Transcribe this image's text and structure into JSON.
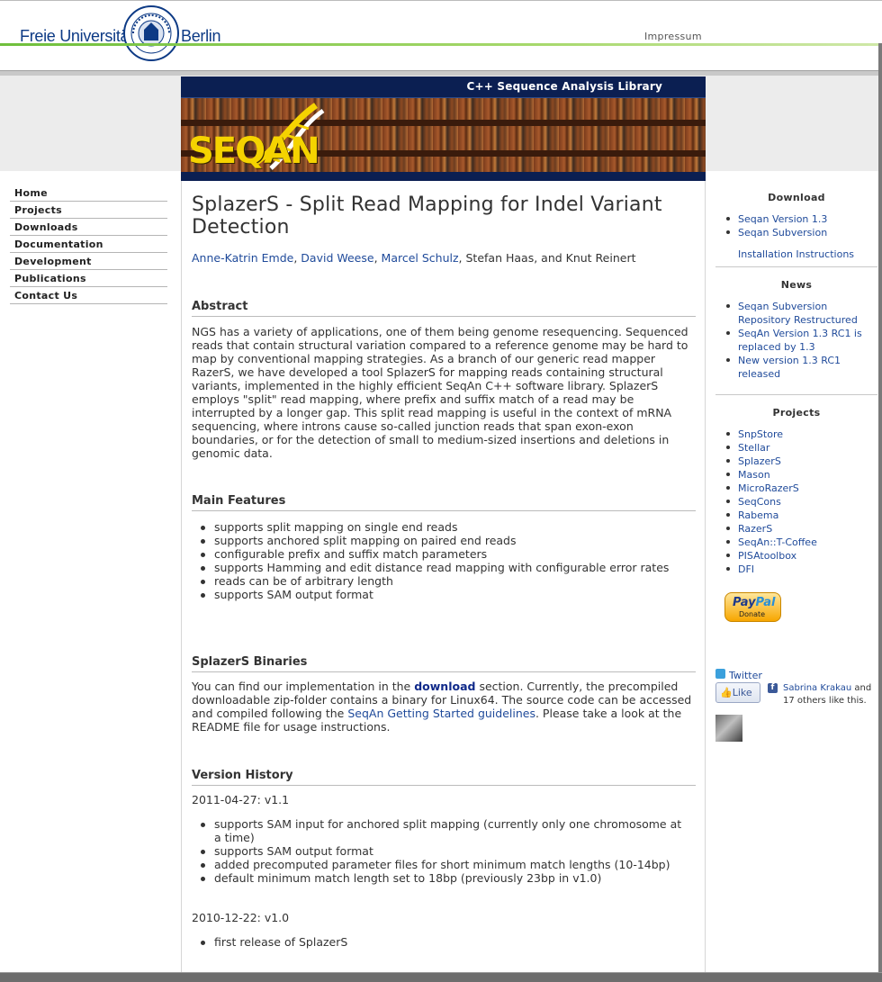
{
  "header": {
    "fu_left": "Freie Universität",
    "fu_right": "Berlin",
    "impressum": "Impressum"
  },
  "banner": {
    "title": "C++ Sequence Analysis Library",
    "logo": "SEQAN"
  },
  "nav": {
    "items": [
      {
        "label": "Home"
      },
      {
        "label": "Projects"
      },
      {
        "label": "Downloads"
      },
      {
        "label": "Documentation"
      },
      {
        "label": "Development"
      },
      {
        "label": "Publications"
      },
      {
        "label": "Contact Us"
      }
    ]
  },
  "main": {
    "title": "SplazerS - Split Read Mapping for Indel Variant Detection",
    "authors": {
      "a1": "Anne-Katrin Emde",
      "a2": "David Weese",
      "a3": "Marcel Schulz",
      "rest": ", Stefan Haas, and Knut Reinert"
    },
    "abstract_heading": "Abstract",
    "abstract_text": "NGS has a variety of applications, one of them being genome resequencing. Sequenced reads that contain structural variation compared to a reference genome may be hard to map by conventional mapping strategies. As a branch of our generic read mapper RazerS, we have developed a tool SplazerS for mapping reads containing structural variants, implemented in the highly efficient SeqAn C++ software library. SplazerS employs \"split\" read mapping, where prefix and suffix match of a read may be interrupted by a longer gap. This split read mapping is useful in the context of mRNA sequencing, where introns cause so-called junction reads that span exon-exon boundaries, or for the detection of small to medium-sized insertions and deletions in genomic data.",
    "features_heading": "Main Features",
    "features": [
      "supports split mapping on single end reads",
      "supports anchored split mapping on paired end reads",
      "configurable prefix and suffix match parameters",
      "supports Hamming and edit distance read mapping with configurable error rates",
      "reads can be of arbitrary length",
      "supports SAM output format"
    ],
    "binaries_heading": "SplazerS Binaries",
    "binaries": {
      "t1": "You can find our implementation in the ",
      "link1": "download",
      "t2": " section. Currently, the precompiled downloadable zip-folder contains a binary for Linux64. The source code can be accessed and compiled following the ",
      "link2": "SeqAn Getting Started guidelines",
      "t3": ". Please take a look at the README file for usage instructions."
    },
    "history_heading": "Version History",
    "v11_date": "2011-04-27: v1.1",
    "v11_items": [
      "supports SAM input for anchored split mapping (currently only one chromosome at a time)",
      "supports SAM output format",
      "added precomputed parameter files for short minimum match lengths (10-14bp)",
      "default minimum match length set to 18bp (previously 23bp in v1.0)"
    ],
    "v10_date": "2010-12-22: v1.0",
    "v10_items": [
      "first release of SplazerS"
    ]
  },
  "sidebar": {
    "download_heading": "Download",
    "download_items": [
      "Seqan Version 1.3",
      "Seqan Subversion"
    ],
    "install_link": "Installation Instructions",
    "news_heading": "News",
    "news_items": [
      "Seqan Subversion Repository Restructured",
      "SeqAn Version 1.3 RC1 is replaced by 1.3",
      "New version 1.3 RC1 released"
    ],
    "projects_heading": "Projects",
    "projects": [
      "SnpStore",
      "Stellar",
      "SplazerS",
      "Mason",
      "MicroRazerS",
      "SeqCons",
      "Rabema",
      "RazerS",
      "SeqAn::T-Coffee",
      "PISAtoolbox",
      "DFI"
    ],
    "paypal_word_a": "Pay",
    "paypal_word_b": "Pal",
    "paypal_donate": "Donate",
    "twitter": "Twitter",
    "like": "Like",
    "fb_name": "Sabrina Krakau",
    "fb_name_rest": " and",
    "fb_others": "17 others like this."
  },
  "colors": {
    "link": "#1f4a9a",
    "banner_blue": "#0b1f52",
    "fu_blue": "#0d3a85",
    "green_line": "#6fbf3c"
  }
}
